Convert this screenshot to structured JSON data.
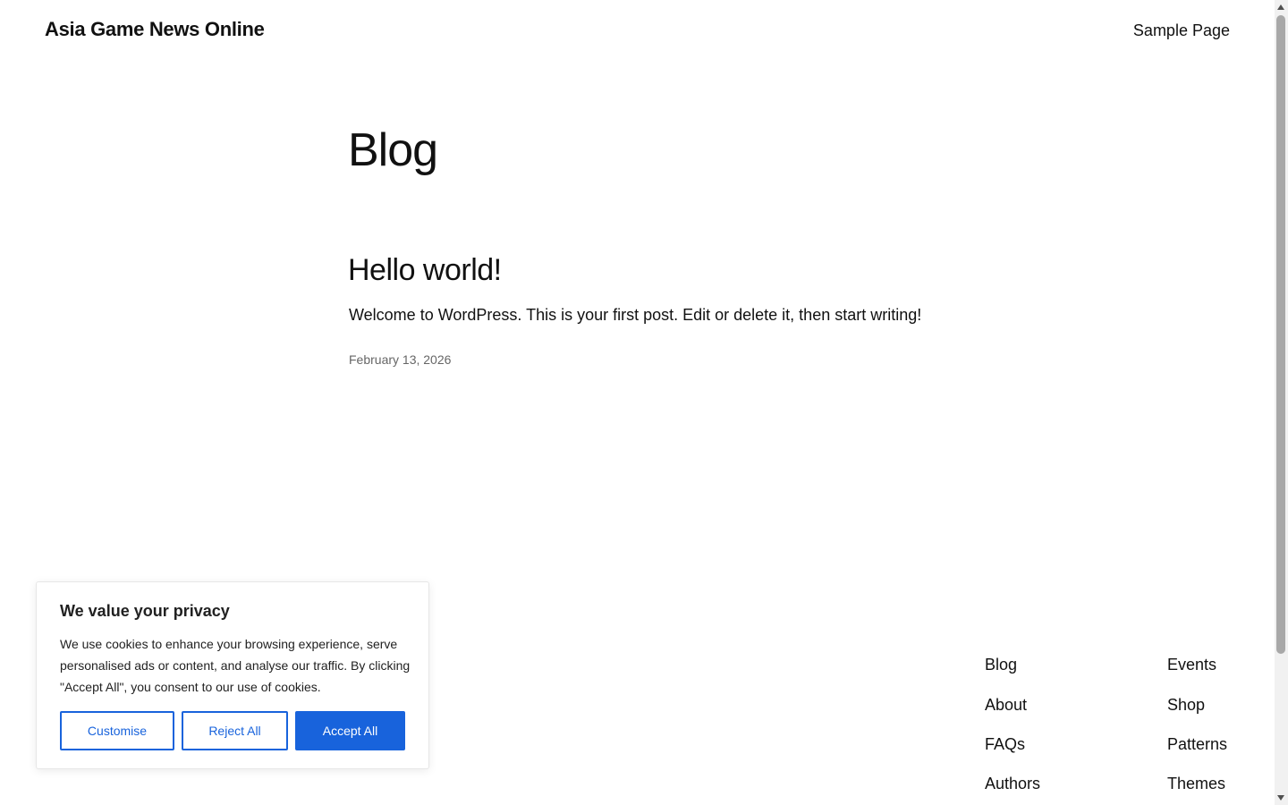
{
  "header": {
    "site_title": "Asia Game News Online",
    "nav": [
      "Sample Page"
    ]
  },
  "main": {
    "page_title": "Blog",
    "post": {
      "title": "Hello world!",
      "excerpt": "Welcome to WordPress. This is your first post. Edit or delete it, then start writing!",
      "date": "February 13, 2026"
    }
  },
  "footer": {
    "nav_col1": [
      "Blog",
      "About",
      "FAQs",
      "Authors"
    ],
    "nav_col2": [
      "Events",
      "Shop",
      "Patterns",
      "Themes"
    ]
  },
  "cookie_banner": {
    "title": "We value your privacy",
    "text": "We use cookies to enhance your browsing experience, serve personalised ads or content, and analyse our traffic. By clicking \"Accept All\", you consent to our use of cookies.",
    "customise_label": "Customise",
    "reject_label": "Reject All",
    "accept_label": "Accept All"
  },
  "colors": {
    "accent": "#1863dc",
    "text": "#111111",
    "muted": "#666666"
  }
}
